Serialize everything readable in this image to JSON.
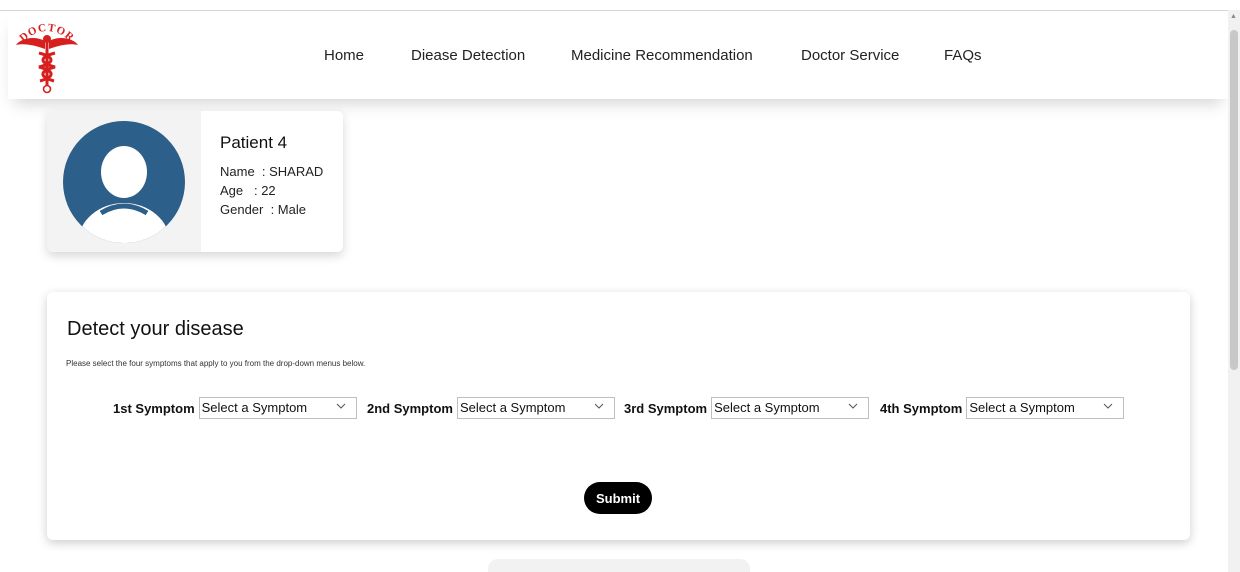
{
  "logo": {
    "text": "DOCTOR",
    "color": "#d62020"
  },
  "nav": {
    "items": [
      {
        "label": "Home"
      },
      {
        "label": "Diease Detection"
      },
      {
        "label": "Medicine Recommendation"
      },
      {
        "label": "Doctor Service"
      },
      {
        "label": "FAQs"
      }
    ]
  },
  "patient": {
    "title": "Patient 4",
    "name_row": "Name  : SHARAD",
    "age_row": "Age   : 22",
    "gender_row": "Gender  : Male",
    "avatar_color": "#2c5f8a"
  },
  "detect": {
    "title": "Detect your disease",
    "subtitle": "Please select the four symptoms that apply to you from the drop-down menus below.",
    "symptoms": [
      {
        "label": "1st Symptom",
        "value": "Select a Symptom"
      },
      {
        "label": "2nd Symptom",
        "value": "Select a Symptom"
      },
      {
        "label": "3rd Symptom",
        "value": "Select a Symptom"
      },
      {
        "label": "4th Symptom",
        "value": "Select a Symptom"
      }
    ],
    "submit_label": "Submit"
  }
}
